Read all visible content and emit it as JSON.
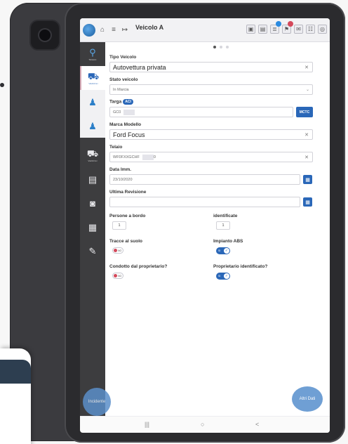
{
  "topbar": {
    "title": "Veicolo A",
    "icons_left": [
      "logo-icon",
      "home-icon",
      "menu-icon",
      "exit-icon"
    ],
    "icons_right": [
      "save-icon",
      "delete-icon",
      "list-icon",
      "flag-icon",
      "mail-icon",
      "group-icon",
      "settings-icon"
    ],
    "badge_colors": {
      "list": "#2a8ae0",
      "flag": "#d4485a"
    }
  },
  "nav": {
    "items": [
      {
        "label": "TRACC",
        "icon": "location-pin-icon"
      },
      {
        "label": "VEICOLI",
        "icon": "car-icon"
      },
      {
        "label": "",
        "icon": "person-icon"
      },
      {
        "label": "",
        "icon": "person-add-icon"
      },
      {
        "label": "VEICOLI",
        "icon": "car-icon"
      },
      {
        "label": "",
        "icon": "document-icon"
      },
      {
        "label": "",
        "icon": "camera-icon"
      },
      {
        "label": "",
        "icon": "table-icon"
      },
      {
        "label": "",
        "icon": "edit-icon"
      }
    ],
    "incidente": "Incidente"
  },
  "form": {
    "tipo_veicolo": {
      "label": "Tipo Veicolo",
      "value": "Autovettura privata"
    },
    "stato_veicolo": {
      "label": "Stato veicolo",
      "value": "In Marcia"
    },
    "targa": {
      "label": "Targa",
      "badge": "ACI",
      "value": "GC0",
      "button": "MCTC"
    },
    "marca_modello": {
      "label": "Marca Modello",
      "value": "Ford Focus"
    },
    "telaio": {
      "label": "Telaio",
      "value": "WF0FXXGCHF",
      "suffix": "0"
    },
    "data_imm": {
      "label": "Data Imm.",
      "value": "23/10/2020"
    },
    "ultima_revisione": {
      "label": "Ultima Revisione",
      "value": ""
    },
    "persone_a_bordo": {
      "label": "Persone a bordo",
      "value": "1"
    },
    "identificate": {
      "label": "identificate",
      "value": "1"
    },
    "tracce_al_suolo": {
      "label": "Tracce al suolo",
      "value": "NO"
    },
    "impianto_abs": {
      "label": "Impianto ABS",
      "value": "SI"
    },
    "condotto_dal_proprietario": {
      "label": "Condotto dal proprietario?",
      "value": "NO"
    },
    "proprietario_identificato": {
      "label": "Proprietario identificato?",
      "value": "SI"
    },
    "altri_dati": "Altri Dati"
  },
  "system_nav": {
    "recents": "|||",
    "home": "○",
    "back": "<"
  },
  "colors": {
    "accent": "#2a67b8",
    "nav_bg": "#3d3d3f",
    "toggle_no": "#d4485a"
  }
}
